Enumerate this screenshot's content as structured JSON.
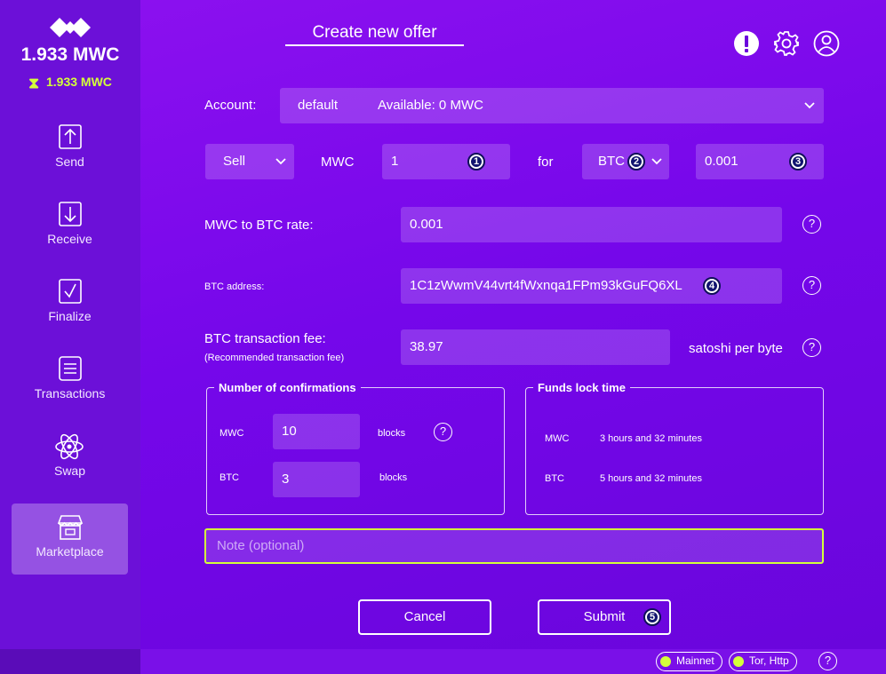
{
  "sidebar": {
    "balance": "1.933 MWC",
    "pending_balance": "1.933 MWC",
    "items": [
      {
        "label": "Send",
        "icon": "send-icon"
      },
      {
        "label": "Receive",
        "icon": "receive-icon"
      },
      {
        "label": "Finalize",
        "icon": "finalize-icon"
      },
      {
        "label": "Transactions",
        "icon": "transactions-icon"
      },
      {
        "label": "Swap",
        "icon": "swap-icon"
      },
      {
        "label": "Marketplace",
        "icon": "marketplace-icon",
        "active": true
      }
    ]
  },
  "header": {
    "title": "Create new offer"
  },
  "form": {
    "account_label": "Account:",
    "account_value": "default",
    "account_available": "Available: 0 MWC",
    "direction": "Sell",
    "mwc_label": "MWC",
    "mwc_amount": "1",
    "for_label": "for",
    "currency": "BTC",
    "btc_amount": "0.001",
    "rate_label": "MWC to BTC rate:",
    "rate_value": "0.001",
    "address_label": "BTC address:",
    "address_value": "1C1zWwmV44vrt4fWxnqa1FPm93kGuFQ6XL",
    "fee_label": "BTC transaction fee:",
    "fee_sublabel": "(Recommended transaction fee)",
    "fee_value": "38.97",
    "fee_unit": "satoshi per byte",
    "help_glyph": "?"
  },
  "confirmations": {
    "title": "Number of confirmations",
    "mwc_label": "MWC",
    "mwc_value": "10",
    "btc_label": "BTC",
    "btc_value": "3",
    "unit": "blocks"
  },
  "lock_time": {
    "title": "Funds lock time",
    "mwc_label": "MWC",
    "mwc_value": "3 hours and 32 minutes",
    "btc_label": "BTC",
    "btc_value": "5 hours and 32 minutes"
  },
  "note": {
    "placeholder": "Note (optional)"
  },
  "buttons": {
    "cancel": "Cancel",
    "submit": "Submit"
  },
  "badges": [
    "1",
    "2",
    "3",
    "4",
    "5"
  ],
  "status": {
    "network": "Mainnet",
    "transport": "Tor, Http",
    "help": "?"
  },
  "colors": {
    "accent": "#d4ff3a",
    "background": "#7507ea",
    "sidebar": "#6c10d8"
  }
}
